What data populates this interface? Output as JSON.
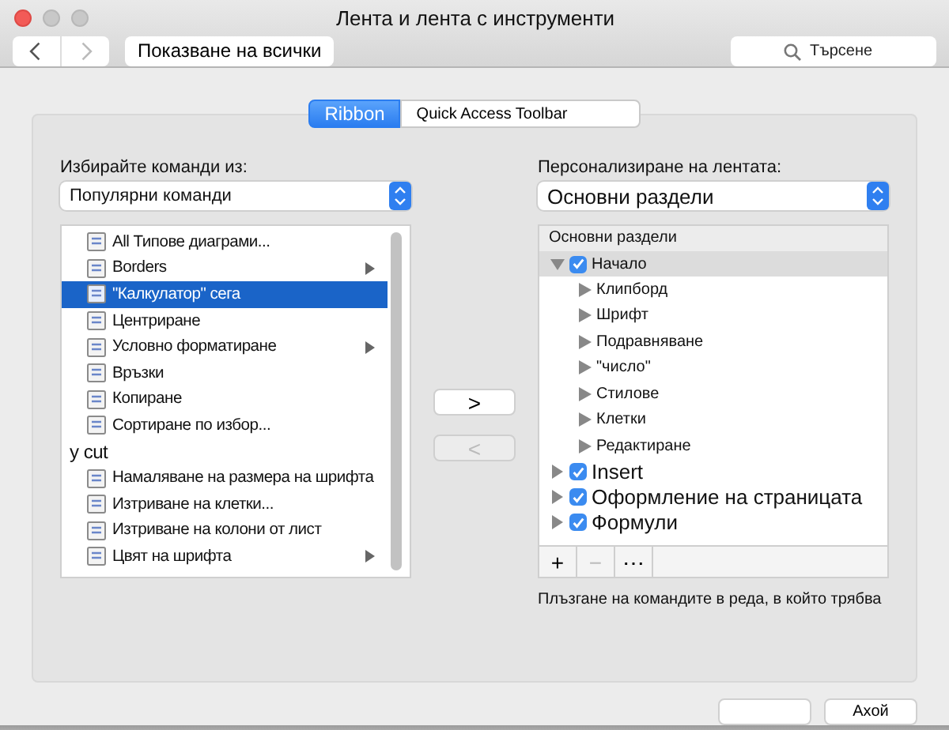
{
  "window": {
    "title": "Лента и лента с инструменти"
  },
  "toolbar": {
    "show_all": "Показване на всички",
    "search": {
      "placeholder": "Търсене"
    }
  },
  "tabs": [
    {
      "label": "Ribbon",
      "selected": true
    },
    {
      "label": "Quick Access Toolbar",
      "selected": false
    }
  ],
  "left": {
    "label": "Избирайте команди из:",
    "dropdown": "Популярни команди",
    "commands": [
      {
        "label": "All Типове диаграми...",
        "kind": "icon",
        "selected": false,
        "submenu": false
      },
      {
        "label": "Borders",
        "kind": "icon",
        "selected": false,
        "submenu": true
      },
      {
        "label": "\"Калкулатор\" сега",
        "kind": "icon",
        "selected": true,
        "submenu": false
      },
      {
        "label": "Центриране",
        "kind": "icon",
        "selected": false,
        "submenu": false
      },
      {
        "label": "Условно форматиране",
        "kind": "icon",
        "selected": false,
        "submenu": true
      },
      {
        "label": "Връзки",
        "kind": "icon",
        "selected": false,
        "submenu": false
      },
      {
        "label": "Копиране",
        "kind": "icon",
        "selected": false,
        "submenu": false
      },
      {
        "label": "Сортиране по избор...",
        "kind": "icon",
        "selected": false,
        "submenu": false
      },
      {
        "label": "y cut",
        "kind": "plain",
        "selected": false,
        "submenu": false
      },
      {
        "label": "Намаляване на размера на шрифта",
        "kind": "icon",
        "selected": false,
        "submenu": false
      },
      {
        "label": "Изтриване на клетки...",
        "kind": "icon",
        "selected": false,
        "submenu": false
      },
      {
        "label": "Изтриване на колони от лист",
        "kind": "icon",
        "selected": false,
        "submenu": false
      },
      {
        "label": "Цвят на шрифта",
        "kind": "icon",
        "selected": false,
        "submenu": true
      }
    ]
  },
  "move_buttons": [
    {
      "label": ">",
      "disabled": false
    },
    {
      "label": "<",
      "disabled": true
    }
  ],
  "right": {
    "label": "Персонализиране на лентата:",
    "dropdown": "Основни раздели",
    "header": "Основни раздели",
    "tabs": [
      {
        "label": "Начало",
        "checked": true,
        "expanded": true,
        "selected": true,
        "children": [
          {
            "label": "Клипборд"
          },
          {
            "label": "Шрифт"
          },
          {
            "label": "Подравняване"
          },
          {
            "label": "\"число\""
          },
          {
            "label": "Стилове"
          },
          {
            "label": "Клетки"
          },
          {
            "label": "Редактиране"
          }
        ]
      },
      {
        "label": "Insert",
        "checked": true,
        "expanded": false,
        "selected": false
      },
      {
        "label": "Оформление на страницата",
        "checked": true,
        "expanded": false,
        "selected": false
      },
      {
        "label": "Формули",
        "checked": true,
        "expanded": false,
        "selected": false
      }
    ],
    "tools": [
      {
        "label": "+",
        "disabled": false
      },
      {
        "label": "−",
        "disabled": true
      },
      {
        "label": "⋯",
        "disabled": false
      }
    ],
    "note": "Плъзгане на командите в реда, в който трябва"
  },
  "footer": {
    "ok": "Ахой"
  }
}
